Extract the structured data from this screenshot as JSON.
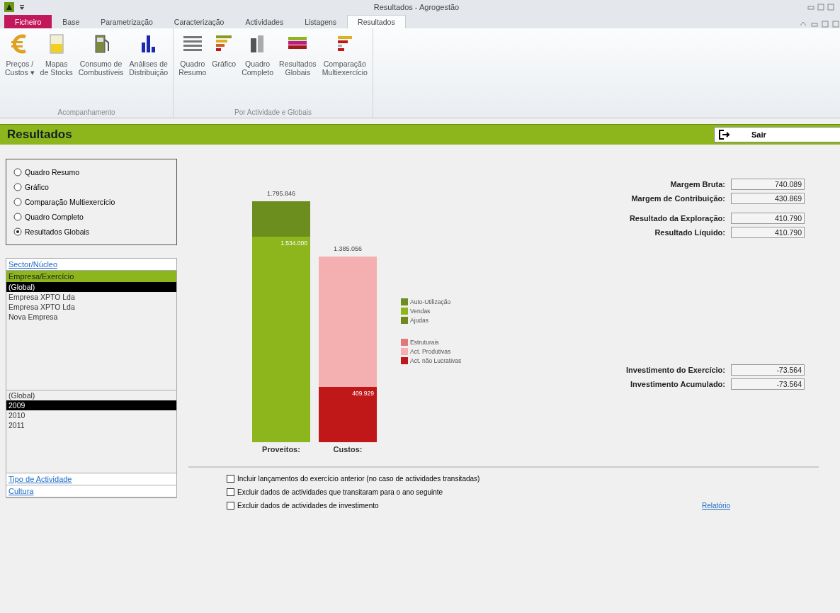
{
  "window": {
    "title": "Resultados - Agrogestão"
  },
  "menu_tabs": [
    {
      "label": "Ficheiro",
      "kind": "file",
      "selected": false
    },
    {
      "label": "Base",
      "kind": "tab",
      "selected": false
    },
    {
      "label": "Parametrização",
      "kind": "tab",
      "selected": false
    },
    {
      "label": "Caracterização",
      "kind": "tab",
      "selected": false
    },
    {
      "label": "Actividades",
      "kind": "tab",
      "selected": false
    },
    {
      "label": "Listagens",
      "kind": "tab",
      "selected": false
    },
    {
      "label": "Resultados",
      "kind": "tab",
      "selected": true
    }
  ],
  "ribbon": {
    "groups": [
      {
        "label": "Acompanhamento",
        "buttons": [
          {
            "kind": "euro",
            "lines": [
              "Preços /",
              "Custos ▾"
            ]
          },
          {
            "kind": "stock",
            "lines": [
              "Mapas",
              "de Stocks"
            ]
          },
          {
            "kind": "fuel",
            "lines": [
              "Consumo de",
              "Combustíveis"
            ]
          },
          {
            "kind": "columns",
            "lines": [
              "Análises de",
              "Distribuição"
            ]
          }
        ]
      },
      {
        "label": "Por Actividade e Globais",
        "buttons": [
          {
            "kind": "table",
            "lines": [
              "Quadro",
              "Resumo"
            ]
          },
          {
            "kind": "hbars",
            "lines": [
              "Gráfico"
            ]
          },
          {
            "kind": "full",
            "lines": [
              "Quadro",
              "Completo"
            ]
          },
          {
            "kind": "stripes",
            "lines": [
              "Resultados",
              "Globais"
            ]
          },
          {
            "kind": "compare",
            "lines": [
              "Comparação",
              "Multiexercício"
            ]
          }
        ]
      }
    ]
  },
  "header": {
    "title": "Resultados",
    "exit_button": "Sair"
  },
  "view_options": [
    {
      "label": "Quadro Resumo",
      "selected": false
    },
    {
      "label": "Gráfico",
      "selected": false
    },
    {
      "label": "Comparação Multiexercício",
      "selected": false
    },
    {
      "label": "Quadro Completo",
      "selected": false
    },
    {
      "label": "Resultados Globais",
      "selected": true
    }
  ],
  "filters": {
    "sector_link": "Sector/Núcleo",
    "company_header": "Empresa/Exercício",
    "companies": [
      {
        "label": "(Global)",
        "selected": true
      },
      {
        "label": "Empresa XPTO Lda",
        "selected": false
      },
      {
        "label": "Empresa XPTO Lda",
        "selected": false
      },
      {
        "label": "Nova Empresa",
        "selected": false
      }
    ],
    "years": [
      {
        "label": "(Global)",
        "selected": false
      },
      {
        "label": "2009",
        "selected": true
      },
      {
        "label": "2010",
        "selected": false
      },
      {
        "label": "2011",
        "selected": false
      }
    ],
    "activity_type_link": "Tipo de Actividade",
    "crop_link": "Cultura"
  },
  "chart": {
    "bars": [
      {
        "label": "Proveitos:",
        "total": "1.795.846",
        "segments": [
          {
            "color": "#8db51c",
            "label": "1.534.000"
          },
          {
            "color": "#6b8e1e"
          }
        ]
      },
      {
        "label": "Custos:",
        "total": "1.385.056",
        "segments": [
          {
            "color": "#c01818",
            "label": "409.929"
          },
          {
            "color": "#f4b0b0"
          }
        ]
      }
    ],
    "legend": [
      [
        {
          "label": "Auto-Utilização",
          "color": "#6b8e1e"
        },
        {
          "label": "Vendas",
          "color": "#8db51c"
        },
        {
          "label": "Ajudas",
          "color": "#6f8a1a"
        }
      ],
      [
        {
          "label": "Estruturais",
          "color": "#e07a7a"
        },
        {
          "label": "Act. Produtivas",
          "color": "#f4b0b0"
        },
        {
          "label": "Act. não Lucrativas",
          "color": "#c01818"
        }
      ]
    ]
  },
  "metrics": [
    [
      {
        "label": "Margem Bruta:",
        "value": "740.089"
      },
      {
        "label": "Margem de Contribuição:",
        "value": "430.869"
      }
    ],
    [
      {
        "label": "Resultado da Exploração:",
        "value": "410.790"
      },
      {
        "label": "Resultado Líquido:",
        "value": "410.790"
      }
    ],
    [
      {
        "label": "Investimento do Exercício:",
        "value": "-73.564"
      },
      {
        "label": "Investimento Acumulado:",
        "value": "-73.564"
      }
    ]
  ],
  "options": [
    {
      "label": "Incluir lançamentos do exercício anterior (no caso de actividades transitadas)",
      "checked": false
    },
    {
      "label": "Excluir dados de actividades que transitaram para o ano seguinte",
      "checked": false
    },
    {
      "label": "Excluir dados de actividades de investimento",
      "checked": false
    }
  ],
  "report_link": "Relatório"
}
